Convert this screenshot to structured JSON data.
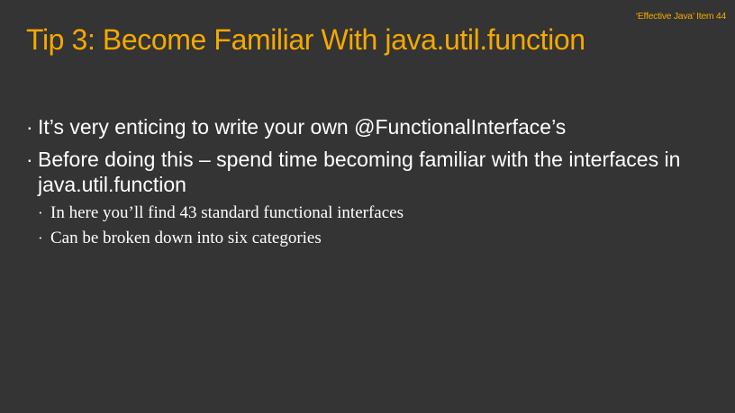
{
  "slide": {
    "reference": "‘Effective Java’ Item 44",
    "title": "Tip 3: Become Familiar With java.util.function",
    "bullet_glyph": "·",
    "bullets": [
      {
        "text": "It’s very enticing to write your own @FunctionalInterface’s"
      },
      {
        "text": "Before doing this – spend time becoming familiar with the interfaces in java.util.function"
      }
    ],
    "sub_bullets": [
      {
        "text": "In here you’ll find 43 standard functional interfaces"
      },
      {
        "text": "Can be broken down into six categories"
      }
    ],
    "colors": {
      "background": "#343434",
      "accent": "#f5a800",
      "text": "#ffffff"
    }
  }
}
